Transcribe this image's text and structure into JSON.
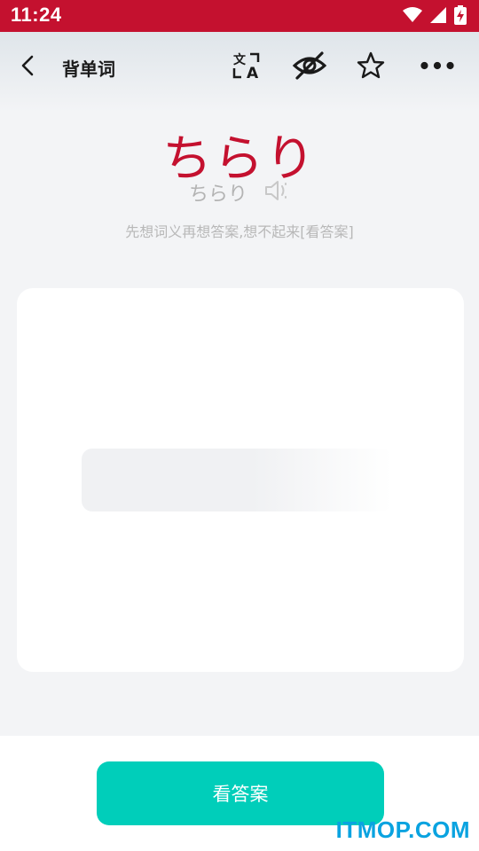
{
  "status_bar": {
    "time": "11:24",
    "icons": [
      "wifi-icon",
      "signal-icon",
      "battery-charging-icon"
    ],
    "color": "#c4112f"
  },
  "header": {
    "title": "背单词",
    "actions": [
      "translate-icon",
      "eye-off-icon",
      "star-icon",
      "more-icon"
    ]
  },
  "word": {
    "main": "ちらり",
    "reading": "ちらり",
    "color": "#c4112f"
  },
  "hint": "先想词义再想答案,想不起来[看答案]",
  "footer": {
    "answer_button": "看答案",
    "button_color": "#00ceba"
  },
  "watermark": "ITMOP.COM"
}
